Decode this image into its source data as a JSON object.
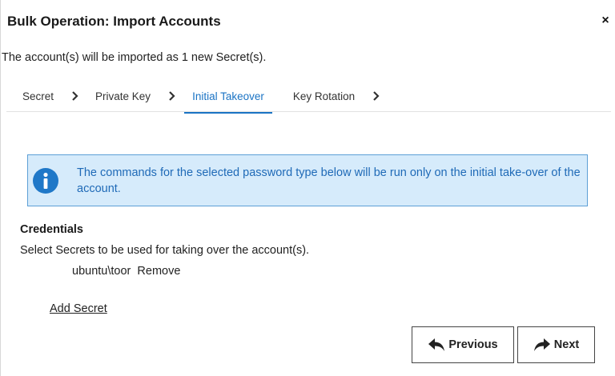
{
  "dialog": {
    "title": "Bulk Operation: Import Accounts",
    "close_glyph": "×",
    "subtitle": "The account(s) will be imported as 1 new Secret(s)."
  },
  "steps": [
    {
      "label": "Secret",
      "active": false
    },
    {
      "label": "Private Key",
      "active": false
    },
    {
      "label": "Initial Takeover",
      "active": true
    },
    {
      "label": "Key Rotation",
      "active": false
    }
  ],
  "info": {
    "icon": "info-icon",
    "text": "The commands for the selected password type below will be run only on the initial take-over of the account."
  },
  "credentials": {
    "heading": "Credentials",
    "description": "Select Secrets to be used for taking over the account(s).",
    "secret_name": "ubuntu\\toor",
    "remove_label": "Remove",
    "add_secret_label": "Add Secret"
  },
  "buttons": {
    "previous_label": "Previous",
    "next_label": "Next"
  },
  "colors": {
    "accent": "#1a73c4",
    "info_bg": "#d6ebfb",
    "info_border": "#5c9fd6",
    "info_text": "#1f6ab7"
  }
}
